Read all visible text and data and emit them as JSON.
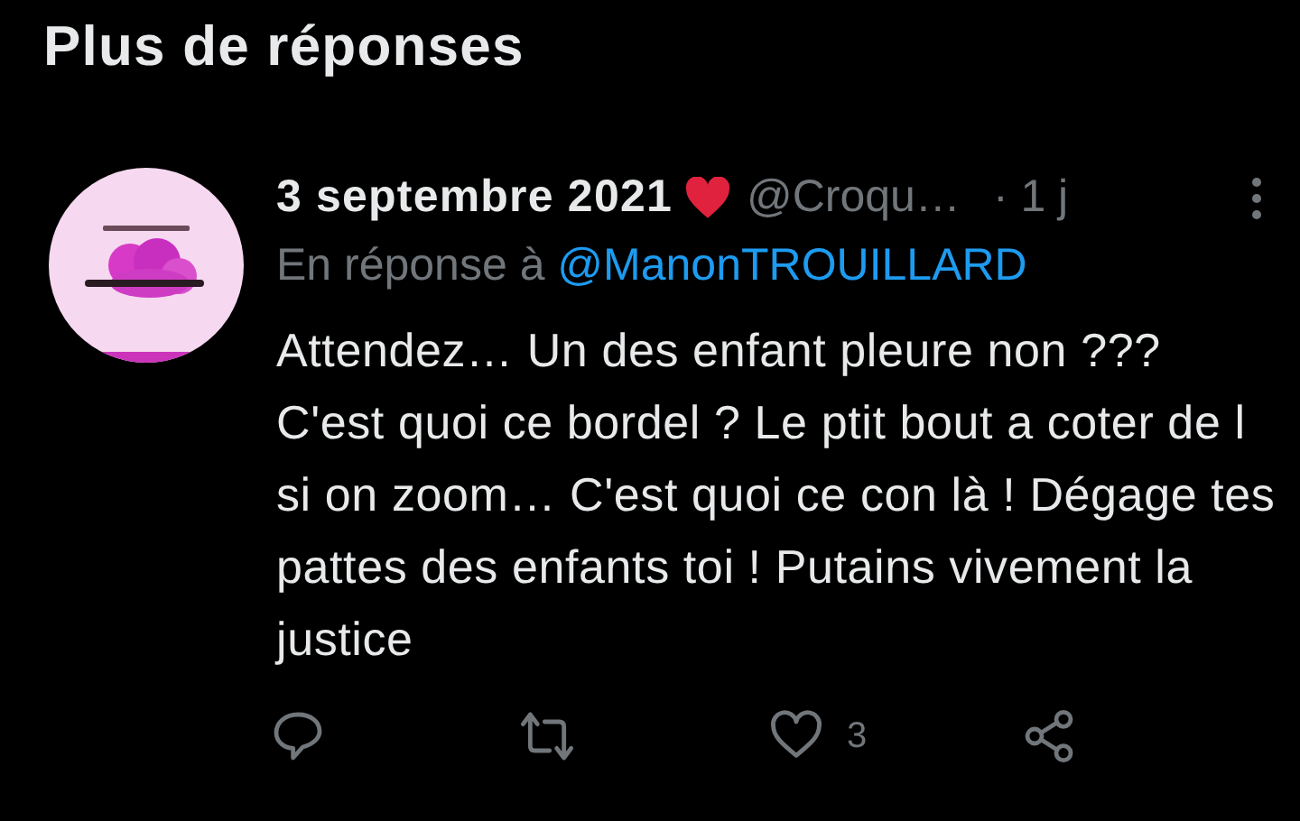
{
  "section_title": "Plus de réponses",
  "tweet": {
    "display_name": "3 septembre 2021",
    "handle": "@Croqu…",
    "time": "· 1 j",
    "reply_prefix": "En réponse à",
    "reply_to": "@ManonTROUILLARD",
    "text": "Attendez… Un des enfant pleure non ??? C'est quoi ce bordel ? Le ptit bout a coter de l si on zoom… C'est quoi ce con là ! Dégage tes pattes des enfants toi ! Putains vivement la justice",
    "actions": [
      {
        "kind": "reply"
      },
      {
        "kind": "retweet"
      },
      {
        "kind": "like",
        "count": "3"
      },
      {
        "kind": "share"
      }
    ]
  }
}
